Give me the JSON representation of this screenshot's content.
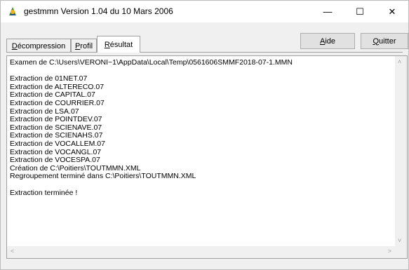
{
  "window": {
    "title": "gestmmn  Version 1.04 du 10 Mars 2006",
    "controls": {
      "minimize": "—",
      "maximize": "☐",
      "close": "✕"
    }
  },
  "tabs": [
    {
      "label_pre": "",
      "label_key": "D",
      "label_post": "écompression",
      "selected": false
    },
    {
      "label_pre": "",
      "label_key": "P",
      "label_post": "rofil",
      "selected": false
    },
    {
      "label_pre": "",
      "label_key": "R",
      "label_post": "ésultat",
      "selected": true
    }
  ],
  "buttons": {
    "aide": {
      "key": "A",
      "rest": "ide"
    },
    "quitter": {
      "key": "Q",
      "rest": "uitter"
    }
  },
  "log_lines": [
    "Examen de C:\\Users\\VERONI~1\\AppData\\Local\\Temp\\0561606SMMF2018-07-1.MMN",
    "",
    "Extraction de 01NET.07",
    "Extraction de ALTERECO.07",
    "Extraction de CAPITAL.07",
    "Extraction de COURRIER.07",
    "Extraction de LSA.07",
    "Extraction de POINTDEV.07",
    "Extraction de SCIENAVE.07",
    "Extraction de SCIENAHS.07",
    "Extraction de VOCALLEM.07",
    "Extraction de VOCANGL.07",
    "Extraction de VOCESPA.07",
    "Création de C:\\Poitiers\\TOUTMMN.XML",
    "Regroupement terminé dans C:\\Poitiers\\TOUTMMN.XML",
    "",
    "Extraction terminée !"
  ],
  "scrollbars": {
    "up": "˄",
    "down": "˅",
    "left": "<",
    "right": ">"
  }
}
